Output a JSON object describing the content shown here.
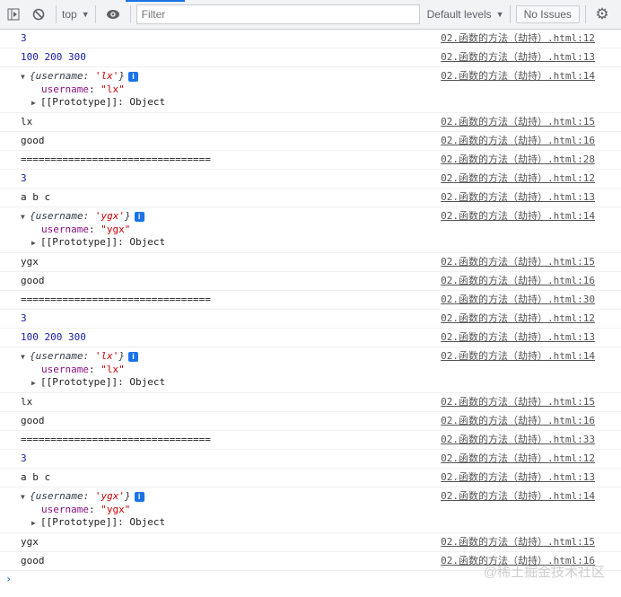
{
  "toolbar": {
    "context": "top",
    "filter_placeholder": "Filter",
    "levels": "Default levels",
    "issues": "No Issues"
  },
  "logs": [
    {
      "type": "num",
      "text": "3",
      "src": "02.函数的方法（劫持）.html:12"
    },
    {
      "type": "num",
      "text": "100 200 300",
      "src": "02.函数的方法（劫持）.html:13"
    },
    {
      "type": "obj",
      "preview_key": "username",
      "preview_val": "'lx'",
      "key": "username",
      "val": "\"lx\"",
      "proto": "[[Prototype]]: Object",
      "src": "02.函数的方法（劫持）.html:14"
    },
    {
      "type": "text",
      "text": "lx",
      "src": "02.函数的方法（劫持）.html:15"
    },
    {
      "type": "text",
      "text": "good",
      "src": "02.函数的方法（劫持）.html:16"
    },
    {
      "type": "text",
      "text": "================================",
      "src": "02.函数的方法（劫持）.html:28"
    },
    {
      "type": "num",
      "text": "3",
      "src": "02.函数的方法（劫持）.html:12"
    },
    {
      "type": "text",
      "text": "a b c",
      "src": "02.函数的方法（劫持）.html:13"
    },
    {
      "type": "obj",
      "preview_key": "username",
      "preview_val": "'ygx'",
      "key": "username",
      "val": "\"ygx\"",
      "proto": "[[Prototype]]: Object",
      "src": "02.函数的方法（劫持）.html:14"
    },
    {
      "type": "text",
      "text": "ygx",
      "src": "02.函数的方法（劫持）.html:15"
    },
    {
      "type": "text",
      "text": "good",
      "src": "02.函数的方法（劫持）.html:16"
    },
    {
      "type": "text",
      "text": "================================",
      "src": "02.函数的方法（劫持）.html:30"
    },
    {
      "type": "num",
      "text": "3",
      "src": "02.函数的方法（劫持）.html:12"
    },
    {
      "type": "num",
      "text": "100 200 300",
      "src": "02.函数的方法（劫持）.html:13"
    },
    {
      "type": "obj",
      "preview_key": "username",
      "preview_val": "'lx'",
      "key": "username",
      "val": "\"lx\"",
      "proto": "[[Prototype]]: Object",
      "src": "02.函数的方法（劫持）.html:14"
    },
    {
      "type": "text",
      "text": "lx",
      "src": "02.函数的方法（劫持）.html:15"
    },
    {
      "type": "text",
      "text": "good",
      "src": "02.函数的方法（劫持）.html:16"
    },
    {
      "type": "text",
      "text": "================================",
      "src": "02.函数的方法（劫持）.html:33"
    },
    {
      "type": "num",
      "text": "3",
      "src": "02.函数的方法（劫持）.html:12"
    },
    {
      "type": "text",
      "text": "a b c",
      "src": "02.函数的方法（劫持）.html:13"
    },
    {
      "type": "obj",
      "preview_key": "username",
      "preview_val": "'ygx'",
      "key": "username",
      "val": "\"ygx\"",
      "proto": "[[Prototype]]: Object",
      "src": "02.函数的方法（劫持）.html:14"
    },
    {
      "type": "text",
      "text": "ygx",
      "src": "02.函数的方法（劫持）.html:15"
    },
    {
      "type": "text",
      "text": "good",
      "src": "02.函数的方法（劫持）.html:16"
    }
  ],
  "watermark": "@稀土掘金技术社区"
}
